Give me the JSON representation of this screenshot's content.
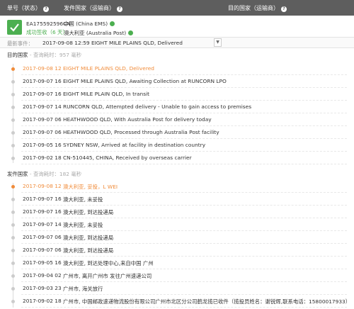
{
  "header": {
    "col_tracking": "单号（状态）",
    "col_origin": "发件国家（运输商）",
    "col_dest": "目的国家（运输商）",
    "help_glyph": "?"
  },
  "summary": {
    "tracking_number": "EA175592596CN",
    "status": "成功签收（6 天）",
    "origin_carrier": "中国 (China EMS)",
    "dest_carrier": "澳大利亚 (Australia Post)",
    "colors": {
      "success": "#4caf50",
      "accent": "#f08c3b",
      "header_bg": "#5e5e5e"
    }
  },
  "latest_event": {
    "label": "最新事件：",
    "text": "2017-09-08 12:59 EIGHT MILE PLAINS QLD, Delivered",
    "toggle_glyph": "▼"
  },
  "destination_section": {
    "title": "目的国家",
    "meta": " - 查询耗时：957 毫秒",
    "events": [
      {
        "time": "2017-09-08 12",
        "desc": "EIGHT MILE PLAINS QLD, Delivered",
        "current": true
      },
      {
        "time": "2017-09-07 16",
        "desc": "EIGHT MILE PLAINS QLD, Awaiting Collection at RUNCORN LPO",
        "current": false
      },
      {
        "time": "2017-09-07 16",
        "desc": "EIGHT MILE PLAIN QLD, In transit",
        "current": false
      },
      {
        "time": "2017-09-07 14",
        "desc": "RUNCORN QLD, Attempted delivery - Unable to gain access to premises",
        "current": false
      },
      {
        "time": "2017-09-07 06",
        "desc": "HEATHWOOD QLD, With Australia Post for delivery today",
        "current": false
      },
      {
        "time": "2017-09-07 06",
        "desc": "HEATHWOOD QLD, Processed through Australia Post facility",
        "current": false
      },
      {
        "time": "2017-09-05 16",
        "desc": "SYDNEY NSW, Arrived at facility in destination country",
        "current": false
      },
      {
        "time": "2017-09-02 18",
        "desc": "CN-510445, CHINA, Received by overseas carrier",
        "current": false
      }
    ]
  },
  "origin_section": {
    "title": "发件国家",
    "meta": " - 查询耗时：182 毫秒",
    "events": [
      {
        "time": "2017-09-08 12",
        "desc": "澳大利亚, 妥投，L WEI",
        "current": true
      },
      {
        "time": "2017-09-07 16",
        "desc": "澳大利亚, 未妥投",
        "current": false
      },
      {
        "time": "2017-09-07 16",
        "desc": "澳大利亚, 到达投递局",
        "current": false
      },
      {
        "time": "2017-09-07 14",
        "desc": "澳大利亚, 未妥投",
        "current": false
      },
      {
        "time": "2017-09-07 06",
        "desc": "澳大利亚, 到达投递局",
        "current": false
      },
      {
        "time": "2017-09-07 06",
        "desc": "澳大利亚, 到达投递局",
        "current": false
      },
      {
        "time": "2017-09-05 16",
        "desc": "澳大利亚, 到达处理中心,来自中国 广州",
        "current": false
      },
      {
        "time": "2017-09-04 02",
        "desc": "广州市, 离开广州市 发往广州速递公司",
        "current": false
      },
      {
        "time": "2017-09-03 23",
        "desc": "广州市, 海关放行",
        "current": false
      },
      {
        "time": "2017-09-02 18",
        "desc": "广州市, 中国邮政速递物流股份有限公司广州市北区分公司鹤龙揽已收件（揽投员姓名：谢锐辉,联系电话：15800017933）",
        "current": false
      }
    ]
  }
}
